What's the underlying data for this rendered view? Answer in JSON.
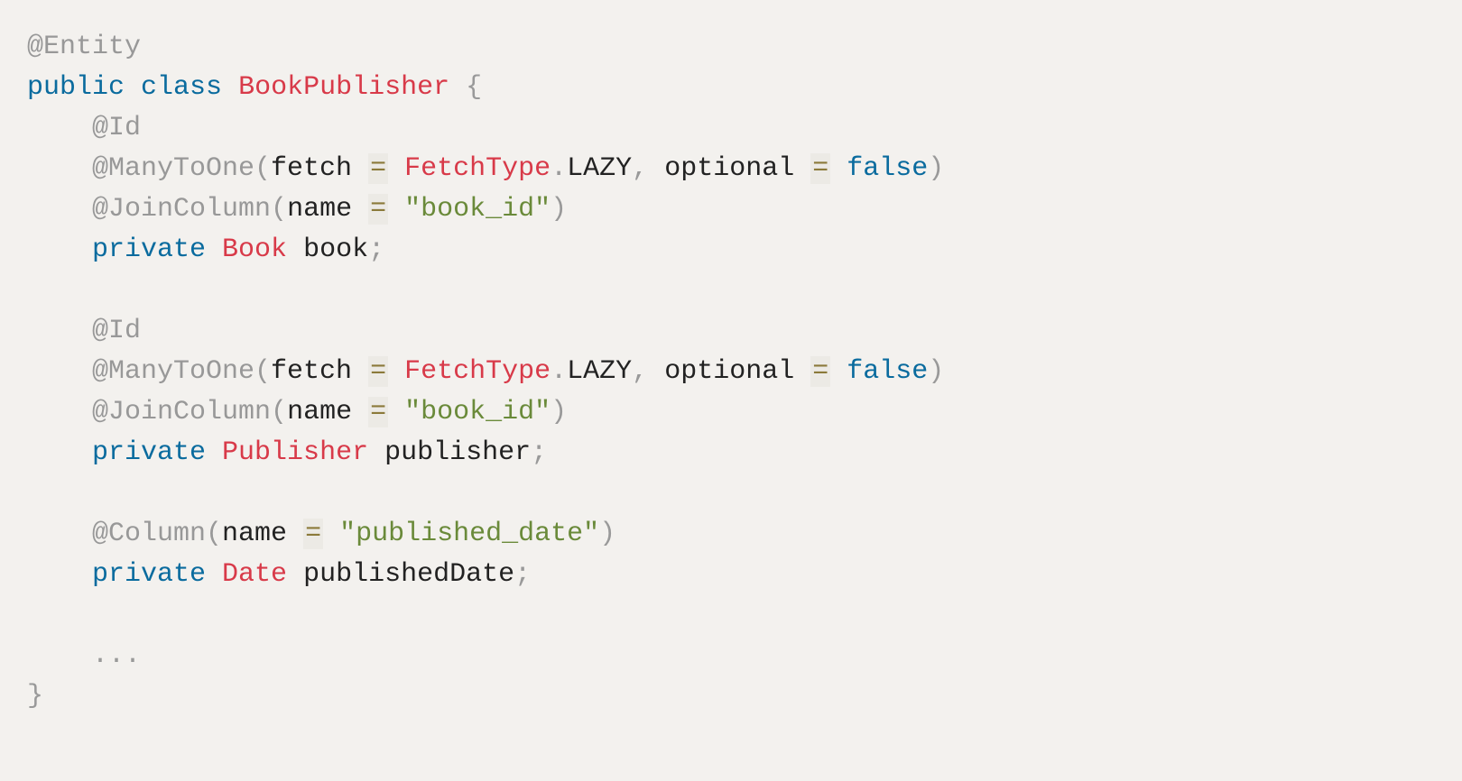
{
  "code": {
    "l1_entity": "@Entity",
    "l2_public": "public",
    "l2_class": "class",
    "l2_name": "BookPublisher",
    "l2_brace": "{",
    "l3_id": "@Id",
    "l4_m2o": "@ManyToOne",
    "l4_lp": "(",
    "l4_fetch": "fetch",
    "l4_eq1": "=",
    "l4_ft": "FetchType",
    "l4_dot": ".",
    "l4_lazy": "LAZY",
    "l4_comma": ",",
    "l4_opt": "optional",
    "l4_eq2": "=",
    "l4_false": "false",
    "l4_rp": ")",
    "l5_jc": "@JoinColumn",
    "l5_lp": "(",
    "l5_name": "name",
    "l5_eq": "=",
    "l5_str": "\"book_id\"",
    "l5_rp": ")",
    "l6_priv": "private",
    "l6_type": "Book",
    "l6_var": "book",
    "l6_semi": ";",
    "l8_id": "@Id",
    "l9_m2o": "@ManyToOne",
    "l9_lp": "(",
    "l9_fetch": "fetch",
    "l9_eq1": "=",
    "l9_ft": "FetchType",
    "l9_dot": ".",
    "l9_lazy": "LAZY",
    "l9_comma": ",",
    "l9_opt": "optional",
    "l9_eq2": "=",
    "l9_false": "false",
    "l9_rp": ")",
    "l10_jc": "@JoinColumn",
    "l10_lp": "(",
    "l10_name": "name",
    "l10_eq": "=",
    "l10_str": "\"book_id\"",
    "l10_rp": ")",
    "l11_priv": "private",
    "l11_type": "Publisher",
    "l11_var": "publisher",
    "l11_semi": ";",
    "l13_col": "@Column",
    "l13_lp": "(",
    "l13_name": "name",
    "l13_eq": "=",
    "l13_str": "\"published_date\"",
    "l13_rp": ")",
    "l14_priv": "private",
    "l14_type": "Date",
    "l14_var": "publishedDate",
    "l14_semi": ";",
    "l16_dots": "...",
    "l17_close": "}"
  }
}
